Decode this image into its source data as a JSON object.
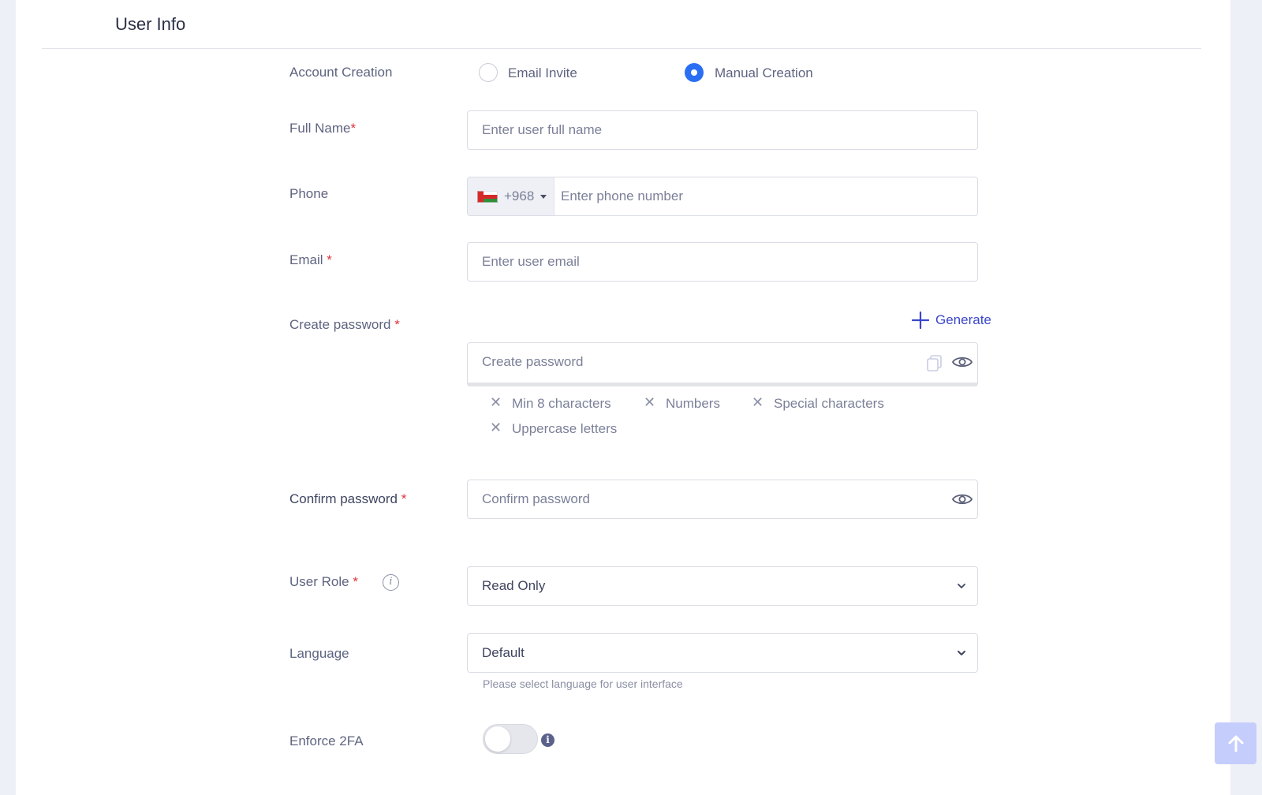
{
  "section": {
    "title": "User Info"
  },
  "account_creation": {
    "label": "Account Creation",
    "options": [
      {
        "label": "Email Invite",
        "selected": false
      },
      {
        "label": "Manual Creation",
        "selected": true
      }
    ]
  },
  "full_name": {
    "label": "Full Name",
    "required_mark": "*",
    "placeholder": "Enter user full name",
    "value": ""
  },
  "phone": {
    "label": "Phone",
    "country_flag": "oman-flag",
    "code": "+968",
    "placeholder": "Enter phone number",
    "value": ""
  },
  "email": {
    "label": "Email",
    "required_mark": "*",
    "placeholder": "Enter user email",
    "value": ""
  },
  "create_password": {
    "label": "Create password",
    "required_mark": "*",
    "generate_label": "Generate",
    "placeholder": "Create password",
    "value": "",
    "requirements": [
      {
        "label": "Min 8 characters",
        "met": false
      },
      {
        "label": "Numbers",
        "met": false
      },
      {
        "label": "Special characters",
        "met": false
      },
      {
        "label": "Uppercase letters",
        "met": false
      }
    ],
    "requirement_mark": "✕"
  },
  "confirm_password": {
    "label": "Confirm password",
    "required_mark": "*",
    "placeholder": "Confirm password",
    "value": ""
  },
  "user_role": {
    "label": "User Role",
    "required_mark": "*",
    "info_glyph": "i",
    "value": "Read Only"
  },
  "language": {
    "label": "Language",
    "value": "Default",
    "hint": "Please select language for user interface"
  },
  "enforce_2fa": {
    "label": "Enforce 2FA",
    "enabled": false,
    "info_glyph": "i"
  },
  "colors": {
    "accent": "#2a6ff3",
    "required": "#e0323c",
    "link": "#3b47c8",
    "scroll_top_bg": "#c4cdfb"
  }
}
